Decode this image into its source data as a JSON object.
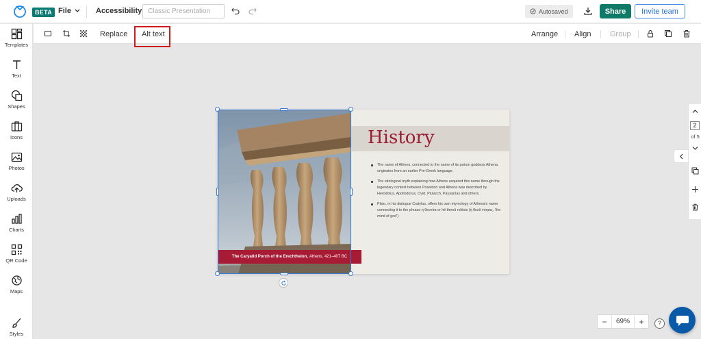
{
  "app": {
    "beta_label": "BETA",
    "file_menu": "File",
    "accessibility": "Accessibility",
    "title_placeholder": "Classic Presentation",
    "autosaved": "Autosaved",
    "share": "Share",
    "invite": "Invite team"
  },
  "sidebar": {
    "items": [
      {
        "label": "Templates",
        "icon": "templates-icon"
      },
      {
        "label": "Text",
        "icon": "text-icon"
      },
      {
        "label": "Shapes",
        "icon": "shapes-icon"
      },
      {
        "label": "Icons",
        "icon": "icons-icon"
      },
      {
        "label": "Photos",
        "icon": "photos-icon"
      },
      {
        "label": "Uploads",
        "icon": "uploads-icon"
      },
      {
        "label": "Charts",
        "icon": "charts-icon"
      },
      {
        "label": "QR Code",
        "icon": "qr-code-icon"
      },
      {
        "label": "Maps",
        "icon": "maps-icon"
      },
      {
        "label": "Styles",
        "icon": "styles-icon"
      }
    ]
  },
  "toolbar": {
    "replace": "Replace",
    "alt_text": "Alt text",
    "arrange": "Arrange",
    "align": "Align",
    "group": "Group"
  },
  "slide": {
    "caption_bold": "The Caryatid Porch of the Erechtheion,",
    "caption_rest": "Athens, 421–407 BC",
    "title": "History",
    "bullets": [
      "The name of Athens, connected to the name of its patron goddess Athena, originates from an earlier Pre-Greek language.",
      "The etiological myth explaining how Athens acquired this name through the legendary contest between Poseidon and Athena was described by Herodotus, Apollodorus, Ovid, Plutarch, Pausanias and others.",
      "Plato, in his dialogue Cratylus, offers his own etymology of Athena's name connecting it to the phrase ἡ θεονόα or hē theoû nóēsis (ἡ θεοῦ νόησις, 'the mind of god')"
    ]
  },
  "pages": {
    "current": "2",
    "of": "of 5"
  },
  "zoom": {
    "minus": "−",
    "value": "69%",
    "plus": "+"
  },
  "help": "?",
  "colors": {
    "brand": "#087a73",
    "share": "#0f7a68",
    "accent_red": "#a81b34",
    "selection": "#3a7bd5",
    "highlight_box": "#d11a1a"
  }
}
